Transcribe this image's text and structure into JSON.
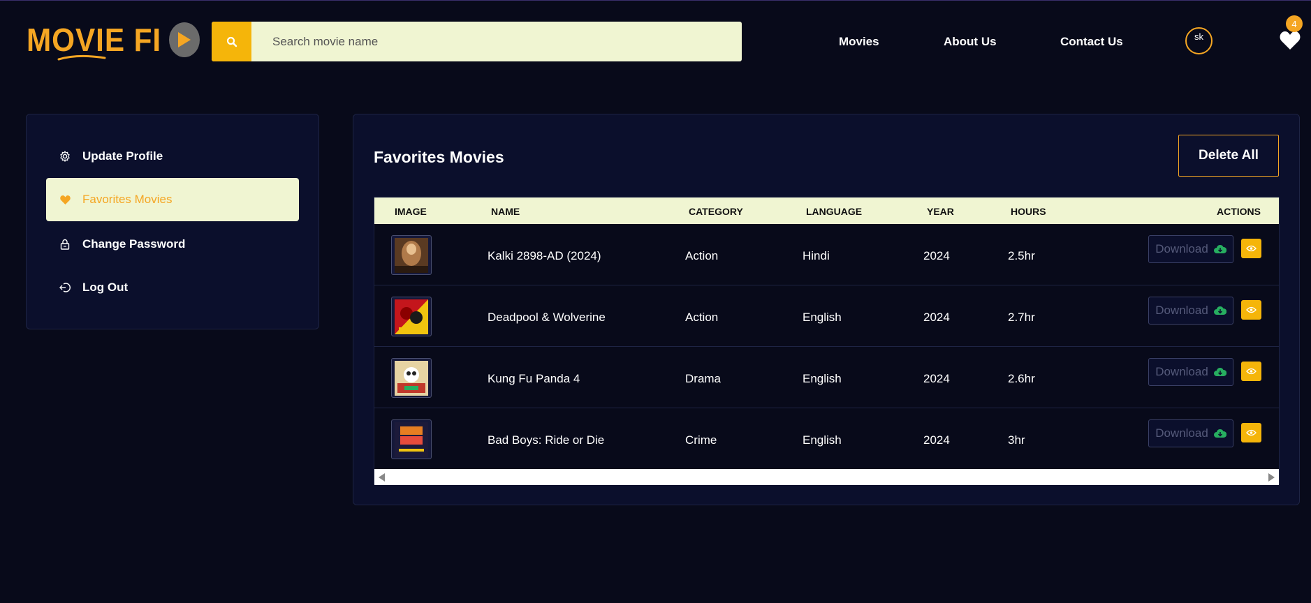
{
  "header": {
    "logo_text": "MOVIE FI",
    "search_placeholder": "Search movie name",
    "nav": [
      "Movies",
      "About Us",
      "Contact Us"
    ],
    "avatar_alt": "sk",
    "favorites_count": "4"
  },
  "sidebar": {
    "items": [
      {
        "label": "Update Profile",
        "icon": "gear-icon"
      },
      {
        "label": "Favorites Movies",
        "icon": "heart-icon"
      },
      {
        "label": "Change Password",
        "icon": "lock-icon"
      },
      {
        "label": "Log Out",
        "icon": "logout-icon"
      }
    ],
    "active": "Favorites Movies"
  },
  "main": {
    "title": "Favorites Movies",
    "delete_all_label": "Delete All",
    "columns": [
      "IMAGE",
      "NAME",
      "CATEGORY",
      "LANGUAGE",
      "YEAR",
      "HOURS",
      "ACTIONS"
    ],
    "rows": [
      {
        "name": "Kalki 2898-AD (2024)",
        "category": "Action",
        "language": "Hindi",
        "year": "2024",
        "hours": "2.5hr"
      },
      {
        "name": "Deadpool & Wolverine",
        "category": "Action",
        "language": "English",
        "year": "2024",
        "hours": "2.7hr"
      },
      {
        "name": "Kung Fu Panda 4",
        "category": "Drama",
        "language": "English",
        "year": "2024",
        "hours": "2.6hr"
      },
      {
        "name": "Bad Boys: Ride or Die",
        "category": "Crime",
        "language": "English",
        "year": "2024",
        "hours": "3hr"
      }
    ],
    "download_label": "Download"
  },
  "colors": {
    "background": "#080a1a",
    "panel": "#0b0f2c",
    "accent": "#f5a623",
    "accent_button": "#f5b50a",
    "highlight": "#f0f5d2",
    "download_icon": "#27ae60"
  }
}
